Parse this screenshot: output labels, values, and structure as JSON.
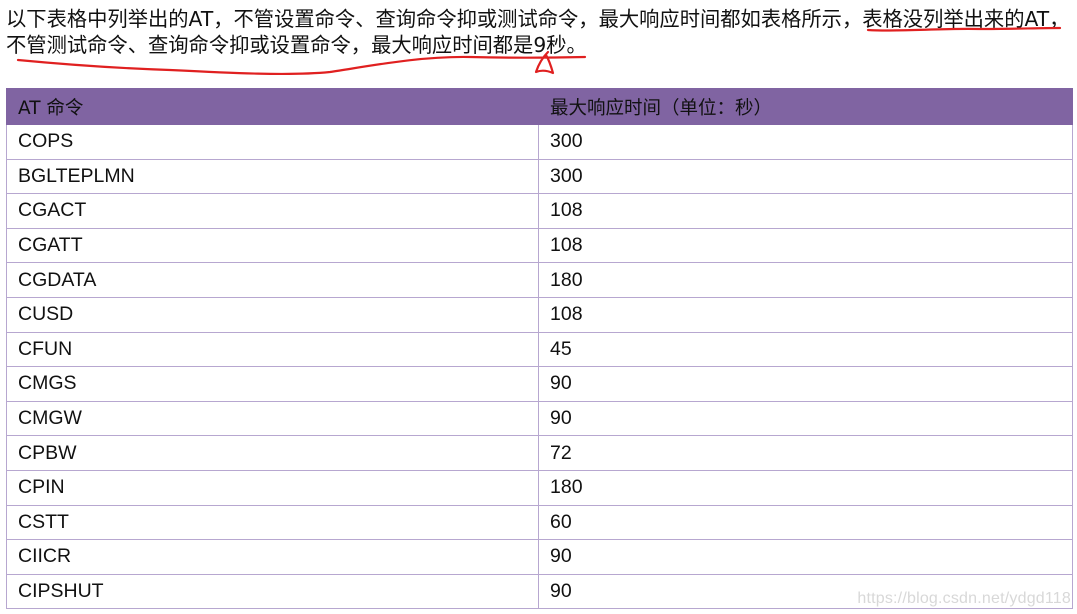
{
  "intro": {
    "line1": "以下表格中列举出的AT，不管设置命令、查询命令抑或测试命令，最大响应时间都如表格所示，表格没列举出来的AT，",
    "line2": "不管测试命令、查询命令抑或设置命令，最大响应时间都是9秒。"
  },
  "annotation": {
    "color": "#e02020"
  },
  "table": {
    "header_bg": "#8064a2",
    "border_color": "#b7a7d0",
    "columns": [
      "AT 命令",
      "最大响应时间（单位：秒）"
    ],
    "rows": [
      [
        "COPS",
        "300"
      ],
      [
        "BGLTEPLMN",
        "300"
      ],
      [
        "CGACT",
        "108"
      ],
      [
        "CGATT",
        "108"
      ],
      [
        "CGDATA",
        "180"
      ],
      [
        "CUSD",
        "108"
      ],
      [
        "CFUN",
        "45"
      ],
      [
        "CMGS",
        "90"
      ],
      [
        "CMGW",
        "90"
      ],
      [
        "CPBW",
        "72"
      ],
      [
        "CPIN",
        "180"
      ],
      [
        "CSTT",
        "60"
      ],
      [
        "CIICR",
        "90"
      ],
      [
        "CIPSHUT",
        "90"
      ]
    ]
  },
  "watermark": "https://blog.csdn.net/ydgd118"
}
